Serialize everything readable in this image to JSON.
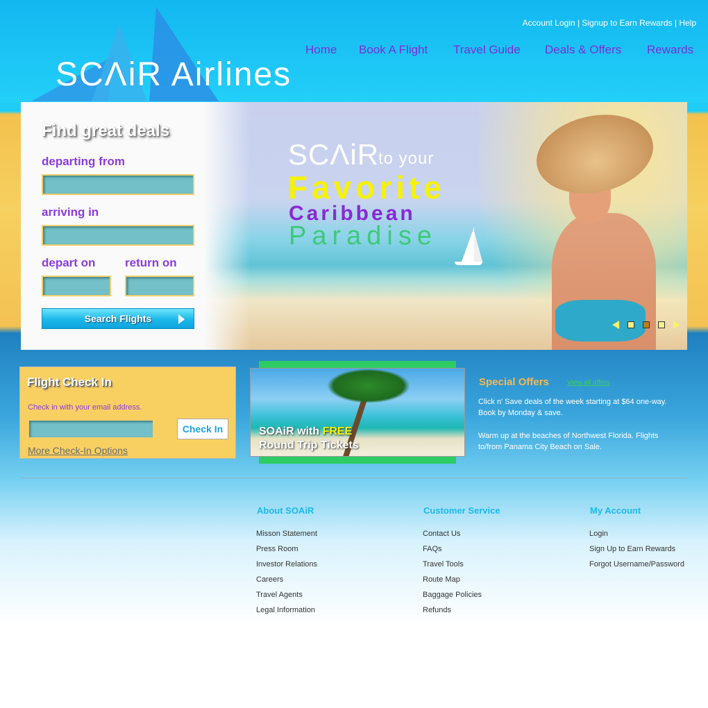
{
  "header": {
    "logo_text": "SCΛiR Airlines",
    "top_links": [
      "Account Login",
      "Signup to Earn Rewards",
      "Help"
    ],
    "separator": "|",
    "nav": [
      "Home",
      "Book A Flight",
      "Travel Guide",
      "Deals & Offers",
      "Rewards"
    ]
  },
  "search": {
    "title": "Find great deals",
    "departing_label": "departing from",
    "arriving_label": "arriving in",
    "depart_label": "depart on",
    "return_label": "return on",
    "departing_value": "",
    "arriving_value": "",
    "depart_value": "",
    "return_value": "",
    "button_label": "Search Flights"
  },
  "promo": {
    "brand": "SCΛiR",
    "to_your": "to your",
    "line1": "Favorite",
    "line2": "Caribbean",
    "line3": "Paradise",
    "slide_count": 3,
    "active_slide": 2
  },
  "checkin": {
    "title": "Flight Check In",
    "subtitle": "Check in with your email address.",
    "email_value": "",
    "button_label": "Check In",
    "more_link": "More Check-In Options"
  },
  "free_tickets": {
    "line1_prefix": "SOAiR with ",
    "line1_highlight": "FREE",
    "line2": "Round Trip Tickets"
  },
  "offers": {
    "title": "Special Offers",
    "view_all": "View all offers",
    "items": [
      "Click n' Save deals of the week starting at $64 one-way. Book by Monday & save.",
      "Warm up at the beaches of Northwest Florida. Flights to/from Panama City Beach on Sale."
    ]
  },
  "footer": {
    "columns": [
      {
        "title": "About SOAiR",
        "links": [
          "Misson Statement",
          "Press Room",
          "Investor Relations",
          "Careers",
          "Travel Agents",
          "Legal Information"
        ]
      },
      {
        "title": "Customer Service",
        "links": [
          "Contact Us",
          "FAQs",
          "Travel Tools",
          "Route Map",
          "Baggage Policies",
          "Refunds"
        ]
      },
      {
        "title": "My Account",
        "links": [
          "Login",
          "Sign Up to Earn Rewards",
          "Forgot Username/Password"
        ]
      }
    ]
  },
  "colors": {
    "sky": "#1ecdf6",
    "purple": "#8b3be0",
    "yellow": "#f6f200",
    "green": "#3ec97a",
    "orange": "#f8b852"
  }
}
